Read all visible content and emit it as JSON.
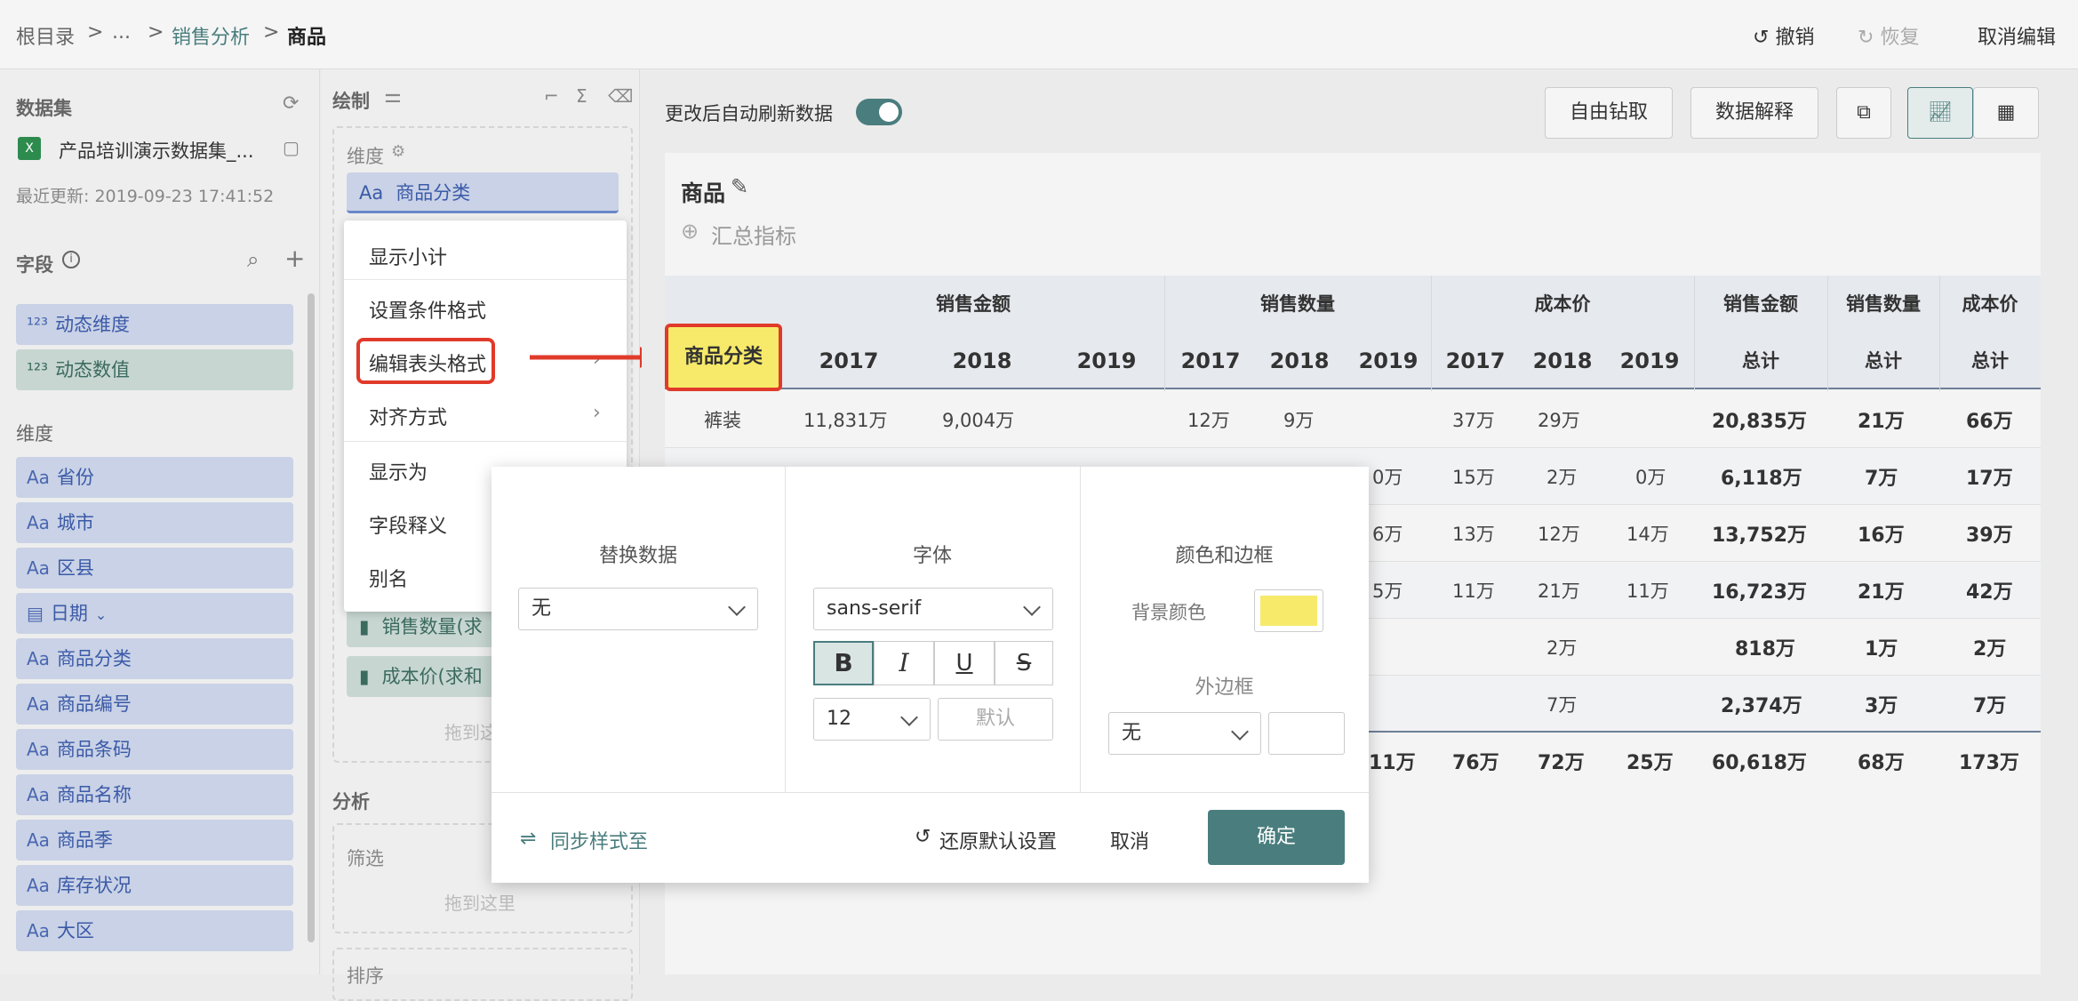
{
  "breadcrumb": {
    "root": "根目录",
    "ellipsis": "...",
    "parent": "销售分析",
    "current": "商品",
    "sep": ">"
  },
  "top_actions": {
    "undo": "撤销",
    "redo": "恢复",
    "cancel_edit": "取消编辑"
  },
  "dataset": {
    "section_title": "数据集",
    "name": "产品培训演示数据集_...",
    "updated": "最近更新: 2019-09-23 17:41:52"
  },
  "fields": {
    "section_title": "字段",
    "dynamic": [
      "动态维度",
      "动态数值"
    ],
    "dimension_title": "维度",
    "dimension_items": [
      "省份",
      "城市",
      "区县",
      "日期",
      "商品分类",
      "商品编号",
      "商品条码",
      "商品名称",
      "商品季",
      "库存状况",
      "大区"
    ]
  },
  "draw": {
    "title": "绘制",
    "dim_label": "维度",
    "dim_item": "商品分类",
    "measure_items": [
      "销售数量(求",
      "成本价(求和"
    ],
    "drop_hint": "拖到这",
    "analysis_title": "分析",
    "filter_label": "筛选",
    "filter_drop": "拖到这里",
    "sort_label": "排序"
  },
  "context_menu": {
    "items": [
      "显示小计",
      "设置条件格式",
      "编辑表头格式",
      "对齐方式",
      "显示为",
      "字段释义",
      "别名"
    ]
  },
  "toolbar": {
    "auto_refresh": "更改后自动刷新数据",
    "drill": "自由钻取",
    "explain": "数据解释"
  },
  "chart_header": {
    "title": "商品",
    "summary": "汇总指标"
  },
  "table": {
    "group_headers": [
      "销售金额",
      "销售数量",
      "成本价",
      "销售金额",
      "销售数量",
      "成本价"
    ],
    "row_header": "商品分类",
    "years": [
      "2017",
      "2018",
      "2019",
      "2017",
      "2018",
      "2019",
      "2017",
      "2018",
      "2019"
    ],
    "total_label": "总计",
    "rows": [
      {
        "cat": "裤装",
        "v": [
          "11,831万",
          "9,004万",
          "",
          "12万",
          "9万",
          "",
          "37万",
          "29万",
          ""
        ],
        "t": [
          "20,835万",
          "21万",
          "66万"
        ]
      },
      {
        "cat": "",
        "v": [
          "",
          "",
          "",
          "",
          "",
          "0万",
          "15万",
          "2万",
          "0万"
        ],
        "t": [
          "6,118万",
          "7万",
          "17万"
        ]
      },
      {
        "cat": "",
        "v": [
          "",
          "",
          "",
          "",
          "",
          "6万",
          "13万",
          "12万",
          "14万"
        ],
        "t": [
          "13,752万",
          "16万",
          "39万"
        ]
      },
      {
        "cat": "",
        "v": [
          "",
          "",
          "",
          "",
          "",
          "5万",
          "11万",
          "21万",
          "11万"
        ],
        "t": [
          "16,723万",
          "21万",
          "42万"
        ]
      },
      {
        "cat": "",
        "v": [
          "",
          "",
          "",
          "",
          "",
          "",
          "",
          "2万",
          ""
        ],
        "t": [
          "818万",
          "1万",
          "2万"
        ]
      },
      {
        "cat": "",
        "v": [
          "",
          "",
          "",
          "",
          "",
          "",
          "",
          "7万",
          ""
        ],
        "t": [
          "2,374万",
          "3万",
          "7万"
        ]
      }
    ],
    "total_row": {
      "v": [
        "11万",
        "76万",
        "72万",
        "25万"
      ],
      "t": [
        "60,618万",
        "68万",
        "173万"
      ]
    }
  },
  "dialog": {
    "replace_title": "替换数据",
    "replace_value": "无",
    "font_title": "字体",
    "font_value": "sans-serif",
    "font_size": "12",
    "default_btn": "默认",
    "color_title": "颜色和边框",
    "bg_color_label": "背景颜色",
    "bg_color": "#f7ea6a",
    "border_title": "外边框",
    "border_value": "无",
    "sync": "同步样式至",
    "restore": "还原默认设置",
    "cancel": "取消",
    "confirm": "确定"
  },
  "colors": {
    "accent": "#4a7d7d",
    "highlight": "#e03a2a",
    "header_yellow": "#f7ea6a"
  }
}
